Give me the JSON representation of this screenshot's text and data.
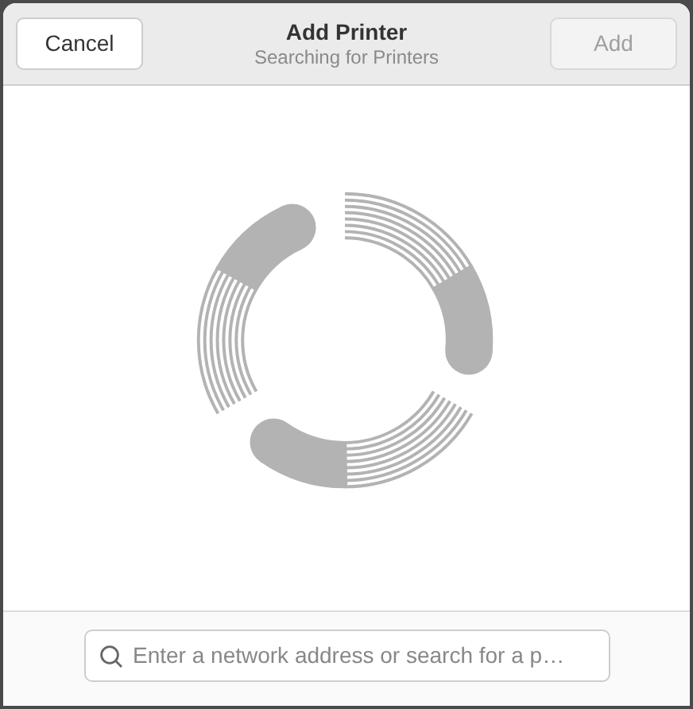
{
  "header": {
    "title": "Add Printer",
    "subtitle": "Searching for Printers"
  },
  "buttons": [
    {
      "label": "Cancel",
      "disabled": false
    },
    {
      "label": "Add",
      "disabled": true
    }
  ],
  "search": {
    "placeholder": "Enter a network address or search for a p…"
  }
}
